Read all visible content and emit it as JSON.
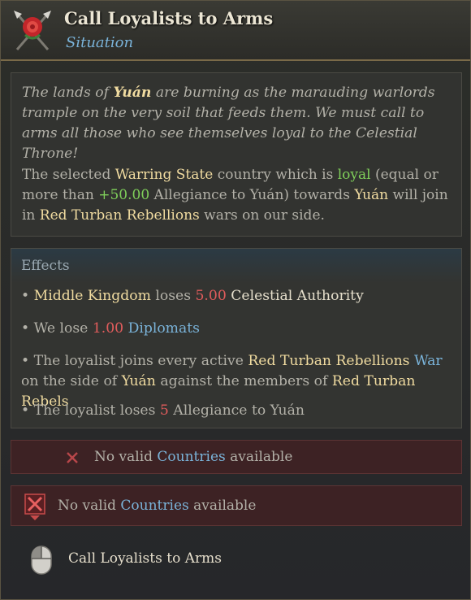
{
  "header": {
    "title": "Call Loyalists to Arms",
    "subtitle": "Situation",
    "icon": "crossed-spears-rose-icon"
  },
  "description": {
    "flavor": {
      "p1": "The lands of ",
      "emph": "Yuán",
      "p2": " are burning as the marauding warlords trample on the very soil that feeds them. We must call to arms all those who see themselves loyal to the Celestial Throne!"
    },
    "body": {
      "p1": "The selected ",
      "warring_state": "Warring State",
      "p2": " country which is ",
      "loyal": "loyal",
      "p3": " (equal or more than ",
      "allegiance_value": "+50.00",
      "p4": " Allegiance to Yuán) towards ",
      "target": "Yuán",
      "p5": " will join in ",
      "rebellion": "Red Turban Rebellions",
      "p6": " wars on our side."
    }
  },
  "effects": {
    "title": "Effects",
    "e1": {
      "bullet": "• ",
      "subject": "Middle Kingdom",
      "verb": " loses ",
      "amount": "5.00",
      "object": " Celestial Authority"
    },
    "e2": {
      "bullet": "• ",
      "text": "We lose ",
      "amount": "1.00",
      "object": "Diplomats"
    },
    "e3": {
      "bullet": "• ",
      "t1": "The loyalist joins every active ",
      "rebellion": "Red Turban Rebellions",
      "war": "War",
      "t2": " on the side of ",
      "side": "Yuán",
      "t3": " against the members of ",
      "enemy": "Red Turban Rebels"
    },
    "e4": {
      "bullet": "• ",
      "t1": "The loyalist loses ",
      "amount": "5",
      "t2": " Allegiance to Yuán"
    }
  },
  "warnings": {
    "w1": {
      "pre": "No valid ",
      "link": "Countries",
      "post": " available"
    },
    "w2": {
      "pre": "No valid ",
      "link": "Countries",
      "post": " available"
    }
  },
  "action": {
    "label": "Call Loyalists to Arms",
    "icon": "mouse-left-click-icon"
  },
  "colors": {
    "highlight": "#f0dba0",
    "negative": "#e05c5c",
    "positive": "#7fcf5a",
    "link": "#7ab3d9",
    "warning_bg": "#3d2224"
  }
}
